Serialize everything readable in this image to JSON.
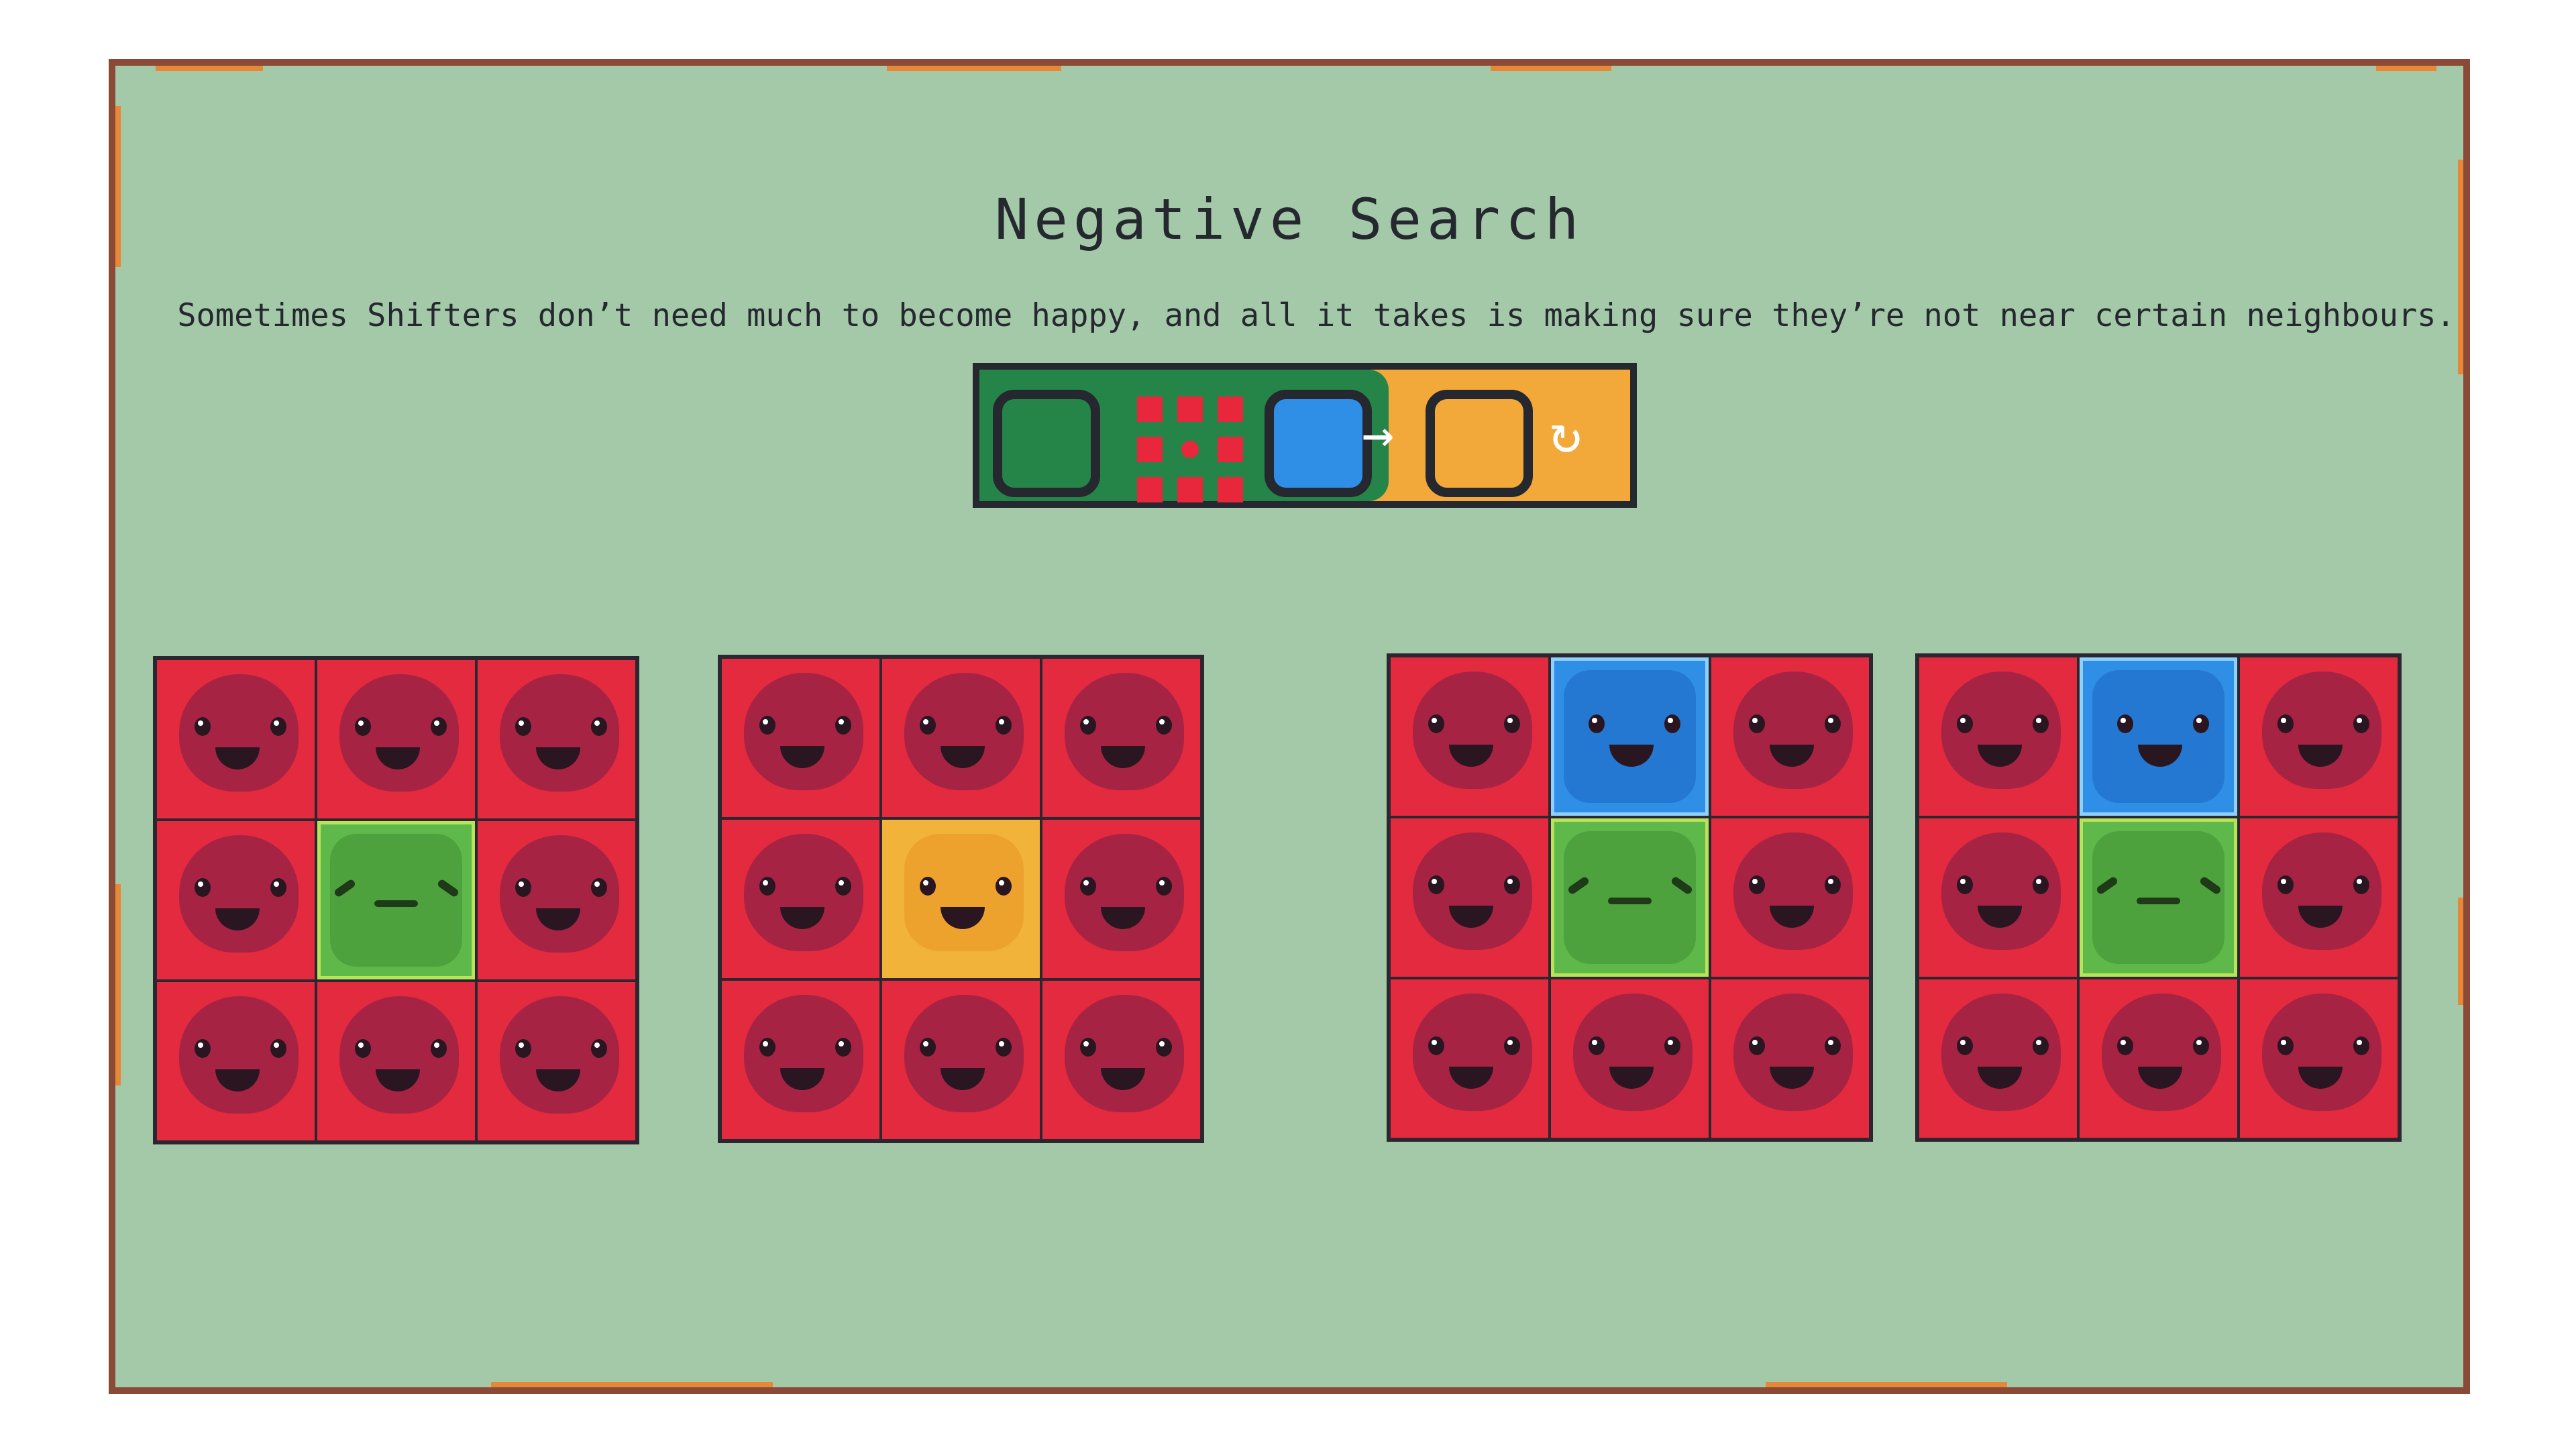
{
  "title": "Negative Search",
  "subtitle": "Sometimes Shifters don’t need much to become happy, and all it takes is making sure they’re not near certain neighbours.",
  "colors": {
    "frame_border": "#8a4a37",
    "frame_bg": "#a4c9a8",
    "accent_orange": "#e68838",
    "red_shifter": "#e32a3e",
    "green_shifter": "#5fb84a",
    "yellow_shifter": "#f1b33a",
    "blue_shifter": "#2f8fe6"
  },
  "rule": {
    "source_color": "green",
    "neighbour_pattern": "all-8-neighbours",
    "forbidden_neighbour_color": "blue",
    "arrow_icon": "→",
    "target_color": "yellow",
    "undo_icon": "↻"
  },
  "boards": [
    {
      "label": "example-1-before",
      "cells": [
        "red",
        "red",
        "red",
        "red",
        "green",
        "red",
        "red",
        "red",
        "red"
      ]
    },
    {
      "label": "example-1-after",
      "cells": [
        "red",
        "red",
        "red",
        "red",
        "yellow",
        "red",
        "red",
        "red",
        "red"
      ]
    },
    {
      "label": "example-2-before",
      "cells": [
        "red",
        "blue",
        "red",
        "red",
        "green",
        "red",
        "red",
        "red",
        "red"
      ]
    },
    {
      "label": "example-2-after",
      "cells": [
        "red",
        "blue",
        "red",
        "red",
        "green",
        "red",
        "red",
        "red",
        "red"
      ]
    }
  ]
}
